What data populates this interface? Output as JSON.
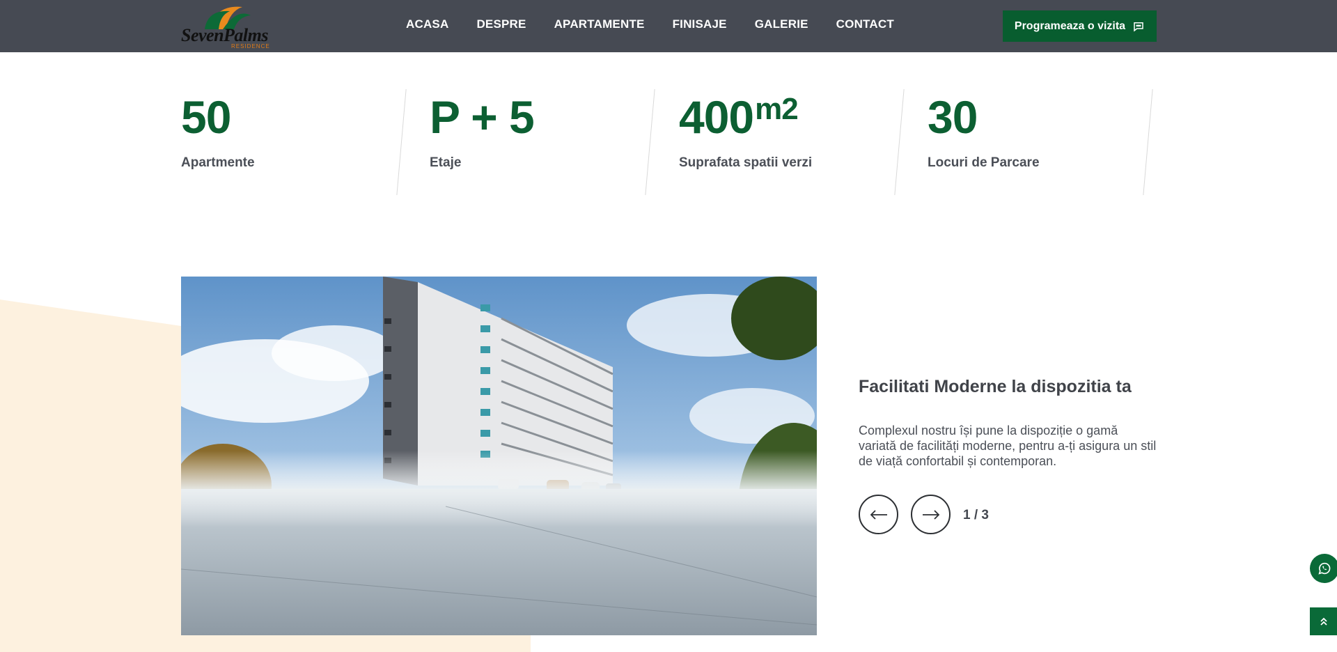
{
  "header": {
    "logo": {
      "brand": "SevenPalms",
      "sub": "RESIDENCE"
    },
    "nav": [
      {
        "label": "ACASA"
      },
      {
        "label": "DESPRE"
      },
      {
        "label": "APARTAMENTE"
      },
      {
        "label": "FINISAJE"
      },
      {
        "label": "GALERIE"
      },
      {
        "label": "CONTACT"
      }
    ],
    "cta_label": "Programeaza o vizita",
    "cta_icon": "chat-bubble-icon"
  },
  "stats": [
    {
      "value": "50",
      "label": "Apartmente"
    },
    {
      "value": "P + 5",
      "label": "Etaje"
    },
    {
      "value": "400",
      "unit": "m2",
      "label": "Suprafata spatii verzi"
    },
    {
      "value": "30",
      "label": "Locuri de Parcare"
    }
  ],
  "facilities": {
    "title": "Facilitati Moderne la dispozitia ta",
    "description": "Complexul nostru își pune la dispoziție o gamă variată de facilități moderne, pentru a-ți asigura un stil de viață confortabil și contemporan.",
    "prev_icon": "arrow-left-icon",
    "next_icon": "arrow-right-icon",
    "pager": "1 / 3"
  },
  "floating": {
    "whatsapp_icon": "whatsapp-icon",
    "top_icon": "chevrons-up-icon"
  },
  "colors": {
    "brand_green": "#085d2f",
    "header_bg": "#464a53",
    "beige": "#fdf1df"
  }
}
